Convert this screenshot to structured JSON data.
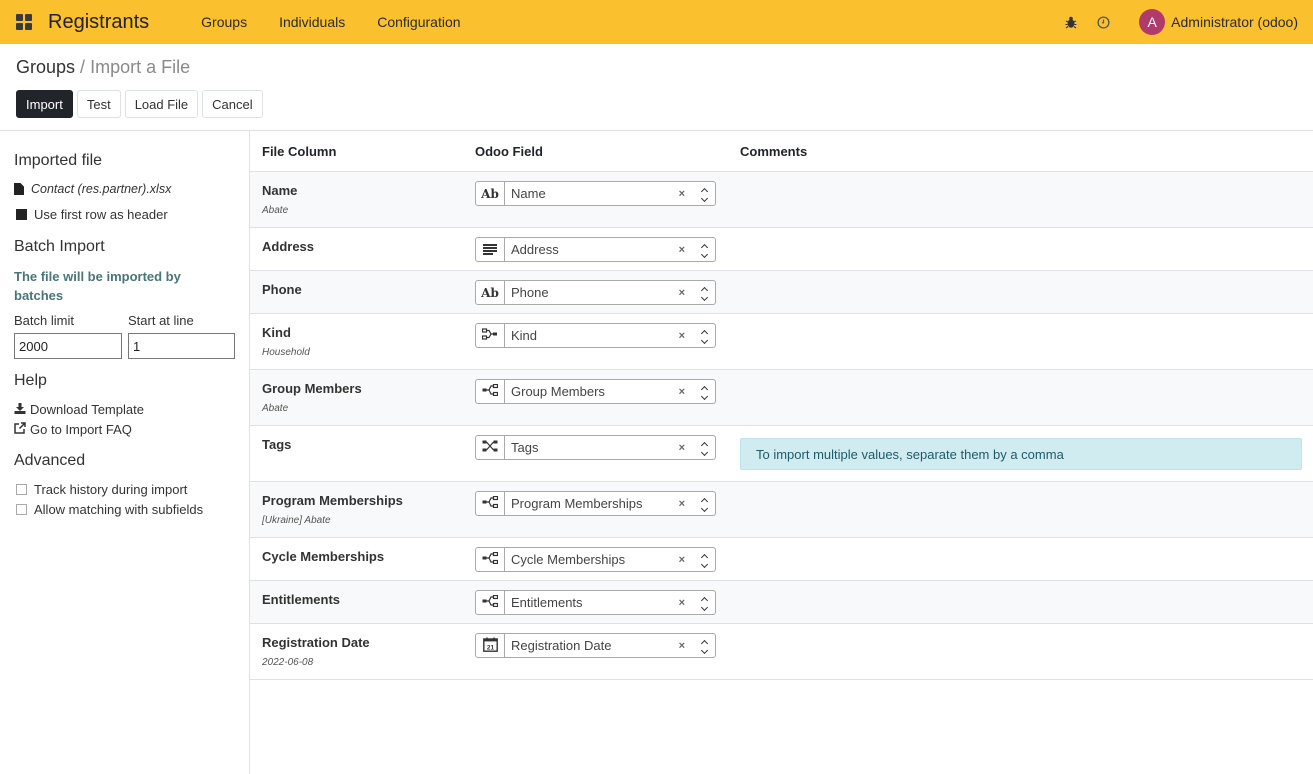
{
  "navbar": {
    "app_title": "Registrants",
    "menu": [
      "Groups",
      "Individuals",
      "Configuration"
    ],
    "avatar_letter": "A",
    "user": "Administrator (odoo)",
    "bg_color": "#fbc02d"
  },
  "breadcrumb": {
    "parent": "Groups",
    "separator": "/",
    "current": "Import a File"
  },
  "buttons": {
    "import": "Import",
    "test": "Test",
    "load_file": "Load File",
    "cancel": "Cancel"
  },
  "sidebar": {
    "imported_file_heading": "Imported file",
    "file_name": "Contact (res.partner).xlsx",
    "use_first_row": "Use first row as header",
    "use_first_row_checked": true,
    "batch_heading": "Batch Import",
    "batch_note": "The file will be imported by batches",
    "batch_limit_label": "Batch limit",
    "batch_limit_value": "2000",
    "start_line_label": "Start at line",
    "start_line_value": "1",
    "help_heading": "Help",
    "download_template": "Download Template",
    "import_faq": "Go to Import FAQ",
    "advanced_heading": "Advanced",
    "track_history": "Track history during import",
    "track_history_checked": false,
    "allow_matching": "Allow matching with subfields",
    "allow_matching_checked": false
  },
  "table": {
    "headers": {
      "file_column": "File Column",
      "odoo_field": "Odoo Field",
      "comments": "Comments"
    },
    "rows": [
      {
        "column": "Name",
        "sample": "Abate",
        "field": "Name",
        "icon": "text-icon"
      },
      {
        "column": "Address",
        "sample": "",
        "field": "Address",
        "icon": "multiline-text-icon"
      },
      {
        "column": "Phone",
        "sample": "",
        "field": "Phone",
        "icon": "text-icon"
      },
      {
        "column": "Kind",
        "sample": "Household",
        "field": "Kind",
        "icon": "many2one-icon"
      },
      {
        "column": "Group Members",
        "sample": "Abate",
        "field": "Group Members",
        "icon": "one2many-icon"
      },
      {
        "column": "Tags",
        "sample": "",
        "field": "Tags",
        "icon": "many2many-icon",
        "comment": "To import multiple values, separate them by a comma"
      },
      {
        "column": "Program Memberships",
        "sample": "[Ukraine] Abate",
        "field": "Program Memberships",
        "icon": "one2many-icon"
      },
      {
        "column": "Cycle Memberships",
        "sample": "",
        "field": "Cycle Memberships",
        "icon": "one2many-icon"
      },
      {
        "column": "Entitlements",
        "sample": "",
        "field": "Entitlements",
        "icon": "one2many-icon"
      },
      {
        "column": "Registration Date",
        "sample": "2022-06-08",
        "field": "Registration Date",
        "icon": "calendar-icon"
      }
    ],
    "text_icon_glyph": "Ab",
    "calendar_day": "21",
    "clear_glyph": "×"
  }
}
